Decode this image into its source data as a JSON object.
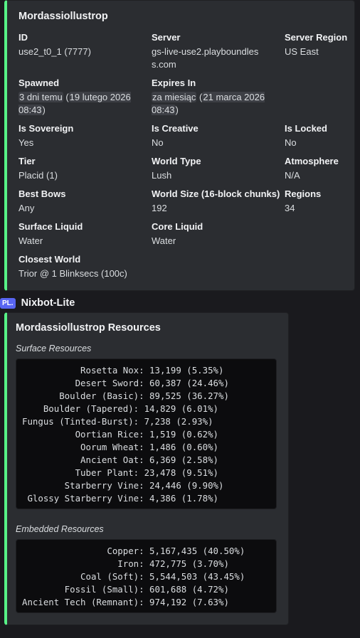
{
  "world_embed": {
    "title": "Mordassiollustrop",
    "fields": {
      "id": {
        "name": "ID",
        "value": "use2_t0_1 (7777)"
      },
      "server": {
        "name": "Server",
        "value": "gs-live-use2.playboundless.com"
      },
      "server_region": {
        "name": "Server Region",
        "value": "US East"
      },
      "spawned": {
        "name": "Spawned",
        "relative": "3 dni temu",
        "absolute": "19 lutego 2026 08:43"
      },
      "expires_in": {
        "name": "Expires In",
        "relative": "za miesiąc",
        "absolute": "21 marca 2026 08:43"
      },
      "is_sovereign": {
        "name": "Is Sovereign",
        "value": "Yes"
      },
      "is_creative": {
        "name": "Is Creative",
        "value": "No"
      },
      "is_locked": {
        "name": "Is Locked",
        "value": "No"
      },
      "tier": {
        "name": "Tier",
        "value": "Placid (1)"
      },
      "world_type": {
        "name": "World Type",
        "value": "Lush"
      },
      "atmosphere": {
        "name": "Atmosphere",
        "value": "N/A"
      },
      "best_bows": {
        "name": "Best Bows",
        "value": "Any"
      },
      "world_size": {
        "name": "World Size (16-block chunks)",
        "value": "192"
      },
      "regions": {
        "name": "Regions",
        "value": "34"
      },
      "surface_liquid": {
        "name": "Surface Liquid",
        "value": "Water"
      },
      "core_liquid": {
        "name": "Core Liquid",
        "value": "Water"
      },
      "closest_world": {
        "name": "Closest World",
        "value": "Trior @ 1 Blinksecs (100c)"
      }
    }
  },
  "bot": {
    "tag": "PL.",
    "name": "Nixbot-Lite"
  },
  "resources_embed": {
    "title": "Mordassiollustrop Resources",
    "surface_label": "Surface Resources",
    "surface_lines": [
      "           Rosetta Nox: 13,199 (5.35%)",
      "          Desert Sword: 60,387 (24.46%)",
      "       Boulder (Basic): 89,525 (36.27%)",
      "    Boulder (Tapered): 14,829 (6.01%)",
      "Fungus (Tinted-Burst): 7,238 (2.93%)",
      "          Oortian Rice: 1,519 (0.62%)",
      "           Oorum Wheat: 1,486 (0.60%)",
      "           Ancient Oat: 6,369 (2.58%)",
      "          Tuber Plant: 23,478 (9.51%)",
      "        Starberry Vine: 24,446 (9.90%)",
      " Glossy Starberry Vine: 4,386 (1.78%)"
    ],
    "embedded_label": "Embedded Resources",
    "embedded_lines": [
      "                Copper: 5,167,435 (40.50%)",
      "                  Iron: 472,775 (3.70%)",
      "           Coal (Soft): 5,544,503 (43.45%)",
      "        Fossil (Small): 601,688 (4.72%)",
      "Ancient Tech (Remnant): 974,192 (7.63%)"
    ]
  }
}
